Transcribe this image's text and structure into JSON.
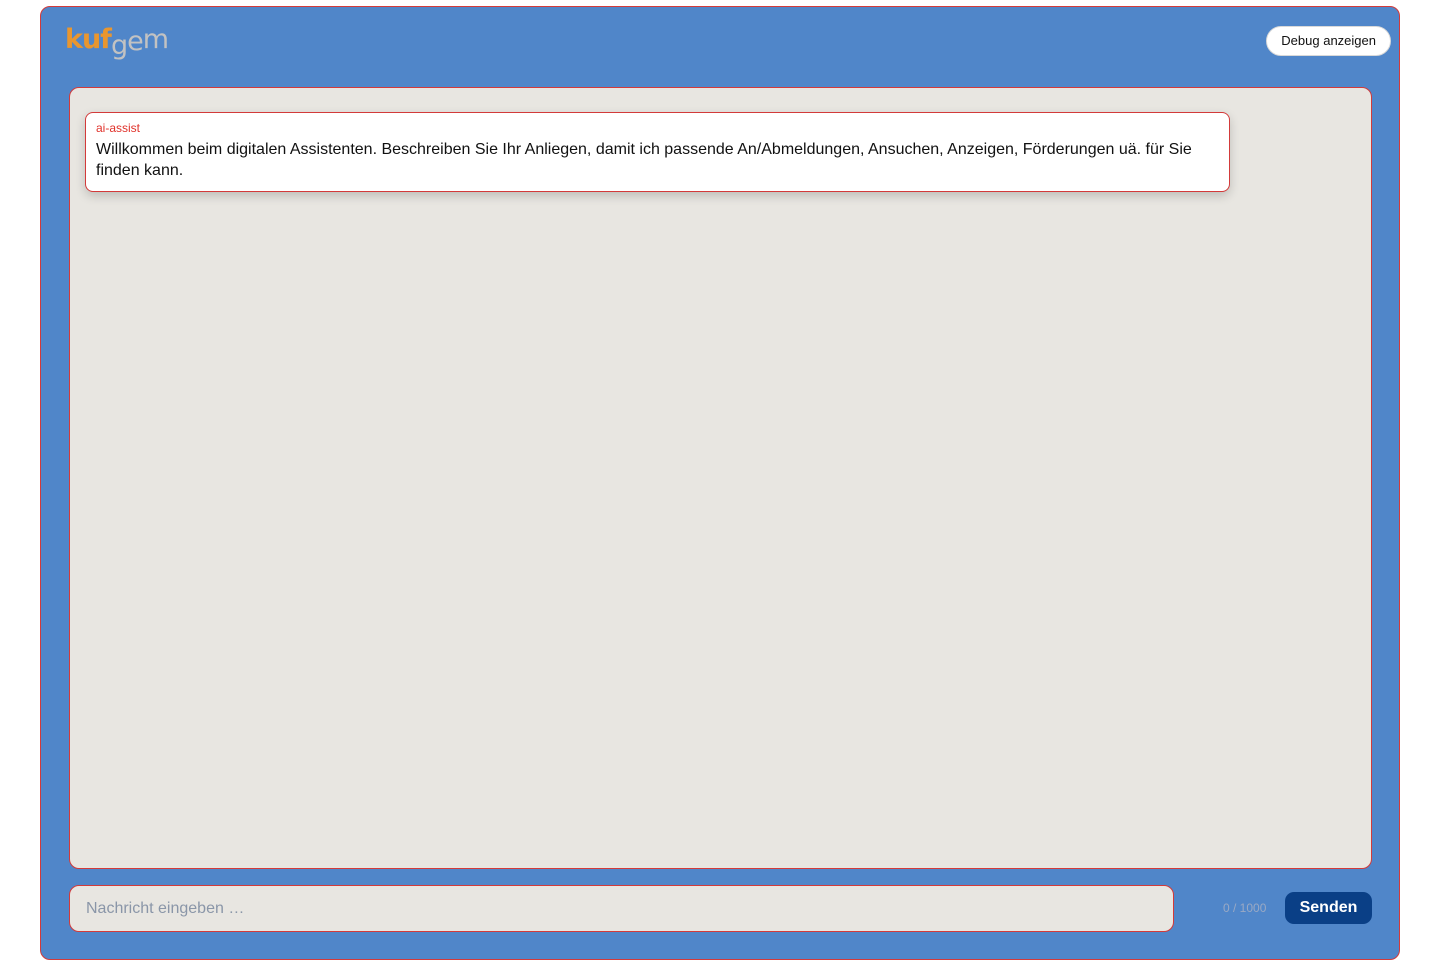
{
  "header": {
    "logo_part1": "kuf",
    "logo_part2_g": "g",
    "logo_part2_e": "e",
    "logo_part2_m": "m",
    "debug_button_label": "Debug anzeigen"
  },
  "chat": {
    "messages": [
      {
        "sender": "ai-assist",
        "text": "Willkommen beim digitalen Assistenten. Beschreiben Sie Ihr Anliegen, damit ich passende An/Abmeldungen, Ansuchen, Anzeigen, Förderungen uä. für Sie finden kann."
      }
    ]
  },
  "composer": {
    "placeholder": "Nachricht eingeben …",
    "value": "",
    "counter": "0 / 1000",
    "send_label": "Senden"
  },
  "colors": {
    "frame_background": "#5086c9",
    "accent_border": "#d33a3a",
    "panel_background": "#e8e6e1",
    "send_button": "#0a3f86",
    "logo_orange": "#e9962f",
    "logo_gray": "#c2c2c2",
    "sender_label": "#e0322b"
  }
}
